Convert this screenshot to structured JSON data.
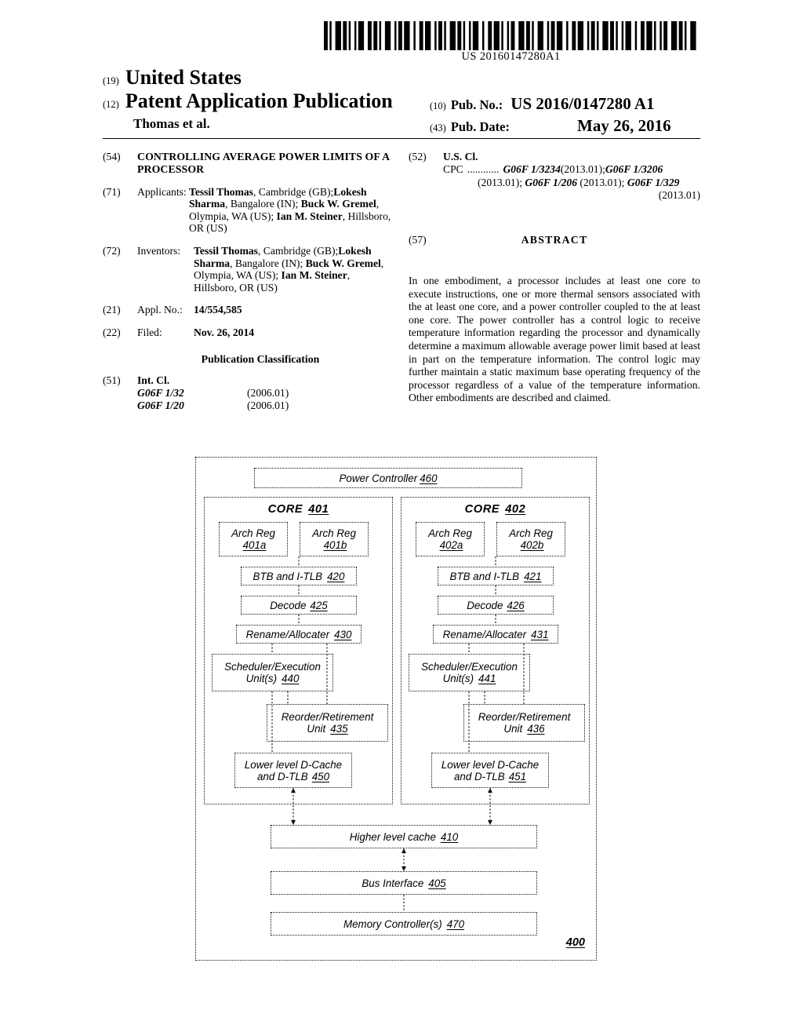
{
  "barcode": {
    "number": "US 20160147280A1",
    "pattern": "1101001110110100101110011011010011100101101110010011011100101101001110110100101110010011011101001011001110110100111001011011100100110111001011010011101101001011100100110111010010110011101101001110"
  },
  "header": {
    "kind_19": "(19)",
    "country": "United States",
    "kind_12": "(12)",
    "doc_type": "Patent Application Publication",
    "authors": "Thomas et al.",
    "pubno_num": "(10)",
    "pubno_label": "Pub. No.:",
    "pubno_value": "US 2016/0147280 A1",
    "pubdate_num": "(43)",
    "pubdate_label": "Pub. Date:",
    "pubdate_value": "May 26, 2016"
  },
  "left_column": {
    "title_num": "(54)",
    "title": "CONTROLLING AVERAGE POWER LIMITS OF A PROCESSOR",
    "applicants_num": "(71)",
    "applicants_label": "Applicants:",
    "applicants": [
      {
        "name": "Tessil Thomas",
        "location": ", Cambridge (GB);"
      },
      {
        "name": "Lokesh Sharma",
        "location": ", Bangalore (IN); "
      },
      {
        "name": "Buck W. Gremel",
        "location": ", Olympia, WA (US); "
      },
      {
        "name": "Ian M. Steiner",
        "location": ", Hillsboro, OR (US)"
      }
    ],
    "inventors_num": "(72)",
    "inventors_label": "Inventors:",
    "inventors": [
      {
        "name": "Tessil Thomas",
        "location": ", Cambridge (GB);"
      },
      {
        "name": "Lokesh Sharma",
        "location": ", Bangalore (IN); "
      },
      {
        "name": "Buck W. Gremel",
        "location": ", Olympia, WA (US); "
      },
      {
        "name": "Ian M. Steiner",
        "location": ", Hillsboro, OR (US)"
      }
    ],
    "applno_num": "(21)",
    "applno_label": "Appl. No.:",
    "applno_value": "14/554,585",
    "filed_num": "(22)",
    "filed_label": "Filed:",
    "filed_value": "Nov. 26, 2014",
    "pubclass_heading": "Publication Classification",
    "intcl_num": "(51)",
    "intcl_label": "Int. Cl.",
    "intcl_rows": [
      {
        "code": "G06F 1/32",
        "version": "(2006.01)"
      },
      {
        "code": "G06F 1/20",
        "version": "(2006.01)"
      }
    ]
  },
  "right_column": {
    "uscl_num": "(52)",
    "uscl_label": "U.S. Cl.",
    "cpc_prefix": "CPC",
    "cpc_dots": "............",
    "cpc_line1_code": "G06F 1/3234",
    "cpc_line1_ver": " (2013.01); ",
    "cpc_line1_code2": "G06F 1/3206",
    "cpc_line2_ver": "(2013.01); ",
    "cpc_line2_code": "G06F 1/206",
    "cpc_line2_ver2": " (2013.01); ",
    "cpc_line2_code2": "G06F 1/329",
    "cpc_line3_ver": "(2013.01)",
    "abstract_num": "(57)",
    "abstract_heading": "ABSTRACT",
    "abstract_text": "In one embodiment, a processor includes at least one core to execute instructions, one or more thermal sensors associated with the at least one core, and a power controller coupled to the at least one core. The power controller has a control logic to receive temperature information regarding the processor and dynamically determine a maximum allowable average power limit based at least in part on the temperature information. The control logic may further maintain a static maximum base operating frequency of the processor regardless of a value of the temperature information. Other embodiments are described and claimed."
  },
  "figure": {
    "figure_ref": "400",
    "power_controller": {
      "label": "Power Controller",
      "ref": "460"
    },
    "core1": {
      "title": "CORE",
      "title_ref": "401",
      "arch_reg_a": {
        "label": "Arch Reg",
        "ref": "401a"
      },
      "arch_reg_b": {
        "label": "Arch Reg",
        "ref": "401b"
      },
      "btb": {
        "label": "BTB and I-TLB",
        "ref": "420"
      },
      "decode": {
        "label": "Decode",
        "ref": "425"
      },
      "rename": {
        "label": "Rename/Allocater",
        "ref": "430"
      },
      "scheduler": {
        "label": "Scheduler/Execution Unit(s)",
        "ref": "440"
      },
      "reorder": {
        "label": "Reorder/Retirement Unit",
        "ref": "435"
      },
      "dcache": {
        "label": "Lower level D-Cache and D-TLB",
        "ref": "450"
      }
    },
    "core2": {
      "title": "CORE",
      "title_ref": "402",
      "arch_reg_a": {
        "label": "Arch Reg",
        "ref": "402a"
      },
      "arch_reg_b": {
        "label": "Arch Reg",
        "ref": "402b"
      },
      "btb": {
        "label": "BTB and I-TLB",
        "ref": "421"
      },
      "decode": {
        "label": "Decode",
        "ref": "426"
      },
      "rename": {
        "label": "Rename/Allocater",
        "ref": "431"
      },
      "scheduler": {
        "label": "Scheduler/Execution Unit(s)",
        "ref": "441"
      },
      "reorder": {
        "label": "Reorder/Retirement Unit",
        "ref": "436"
      },
      "dcache": {
        "label": "Lower level D-Cache and D-TLB",
        "ref": "451"
      }
    },
    "higher_cache": {
      "label": "Higher level cache",
      "ref": "410"
    },
    "bus_interface": {
      "label": "Bus Interface",
      "ref": "405"
    },
    "memory_controller": {
      "label": "Memory Controller(s)",
      "ref": "470"
    }
  }
}
